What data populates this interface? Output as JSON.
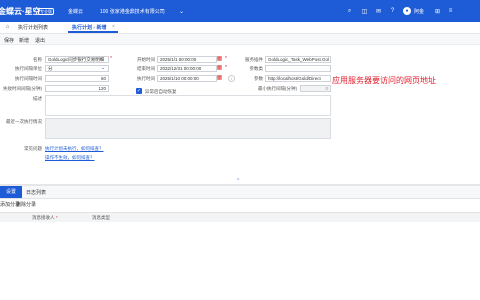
{
  "topbar": {
    "logo": "金蝶云·星空",
    "badge": "专业版",
    "nav_item": "金蝶云",
    "org": "100 张家港金鼎技术有限公司",
    "org_dropdown_icon": "chevron-down-icon",
    "user": "阿金"
  },
  "tabs": [
    {
      "label": "执行计划列表"
    },
    {
      "label": "执行计划 - 新增",
      "close": "×"
    }
  ],
  "toolbar": {
    "save": "保存",
    "new": "新增",
    "exit": "退出"
  },
  "form": {
    "name_label": "名称",
    "name_value": "GoldLogic同步银行交易明细",
    "freq_label": "执行间隔单位",
    "freq_value": "分",
    "interval_label": "执行间隔时间",
    "interval_value": "60",
    "timeout_label": "失败时间间隔(分钟)",
    "timeout_value": "120",
    "desc_label": "描述",
    "lastexec_label": "最近一次执行情况",
    "start_label": "开始时间",
    "start_value": "2025/1/1 00:00:00",
    "end_label": "结束时间",
    "end_value": "2032/12/31 00:00:00",
    "exec_label": "执行时间",
    "exec_value": "2025/1/10 00:00:00",
    "auto_restore_label": "异常后自动恢复",
    "service_label": "服务插件",
    "service_value": "GoldLogic_Task_WebPost.Gol",
    "param_label": "参数类",
    "param_value": "",
    "params_label": "参数",
    "params_value": "http://localhost/Gold/Direct",
    "min_interval_label": "最小执行间隔(分钟)",
    "min_interval_value": "0",
    "faq_label": "常见问题",
    "faq_link1": "执行计划未执行，如何排查？",
    "faq_link2": "操作不生效，如何排查？"
  },
  "annotation": "应用服务器要访问的网页地址",
  "bottom": {
    "tab_active": "设置",
    "tab_log": "日志列表",
    "add_row": "添加分录",
    "delete_row": "删除分录",
    "col_receiver": "消息接收人",
    "col_msgtype": "消息类型"
  }
}
